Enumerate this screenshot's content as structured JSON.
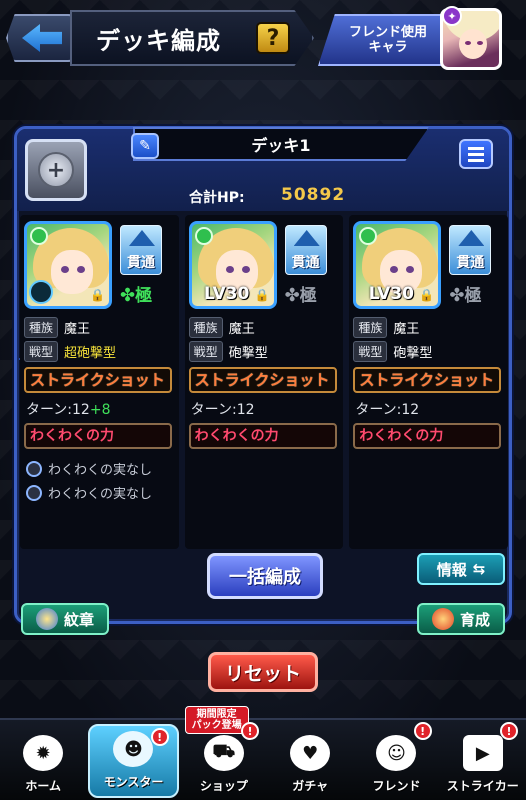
{
  "header": {
    "title": "デッキ編成",
    "help_label": "?",
    "friend_label_line1": "フレンド使用",
    "friend_label_line2": "キャラ"
  },
  "deck": {
    "name": "デッキ1",
    "total_hp_label": "合計HP:",
    "total_hp_value": "50892"
  },
  "members": [
    {
      "level": "",
      "pierce": "貫通",
      "gokuraku": "極",
      "gokuraku_active": true,
      "race_label": "種族",
      "race": "魔王",
      "battle_label": "戦型",
      "battle_type": "超砲撃型",
      "battle_type_highlight": true,
      "strike_shot": "ストライクショット",
      "turn_text": "ターン:12",
      "turn_plus": "+8",
      "ability": "わくわくの力",
      "fruits": [
        "わくわくの実なし",
        "わくわくの実なし"
      ]
    },
    {
      "level": "LV30",
      "pierce": "貫通",
      "gokuraku": "極",
      "gokuraku_active": false,
      "race_label": "種族",
      "race": "魔王",
      "battle_label": "戦型",
      "battle_type": "砲撃型",
      "battle_type_highlight": false,
      "strike_shot": "ストライクショット",
      "turn_text": "ターン:12",
      "turn_plus": "",
      "ability": "わくわくの力",
      "fruits": []
    },
    {
      "level": "LV30",
      "pierce": "貫通",
      "gokuraku": "極",
      "gokuraku_active": false,
      "race_label": "種族",
      "race": "魔王",
      "battle_label": "戦型",
      "battle_type": "砲撃型",
      "battle_type_highlight": false,
      "strike_shot": "ストライクショット",
      "turn_text": "ターン:12",
      "turn_plus": "",
      "ability": "わくわくの力",
      "fruits": []
    }
  ],
  "buttons": {
    "bulk_edit": "一括編成",
    "info": "情報",
    "info_icon": "⇆",
    "emblem": "紋章",
    "grow": "育成",
    "reset": "リセット"
  },
  "nav": {
    "items": [
      {
        "label": "ホーム",
        "icon": "home-icon",
        "badge": ""
      },
      {
        "label": "モンスター",
        "icon": "monster-icon",
        "badge": "!"
      },
      {
        "label": "ショップ",
        "icon": "cart-icon",
        "badge": "!",
        "tag_line1": "期間限定",
        "tag_line2": "パック登場"
      },
      {
        "label": "ガチャ",
        "icon": "egg-icon",
        "badge": ""
      },
      {
        "label": "フレンド",
        "icon": "friends-icon",
        "badge": "!"
      },
      {
        "label": "ストライカー",
        "icon": "card-icon",
        "badge": "!"
      }
    ]
  },
  "colors": {
    "accent": "#3c5fc4",
    "hp_value": "#f4c84a",
    "strike_shot_text": "#ff7b3c",
    "ability_text": "#ff4a6e",
    "highlight_type": "#f5e23a",
    "gokuraku_on": "#3fe05a"
  }
}
